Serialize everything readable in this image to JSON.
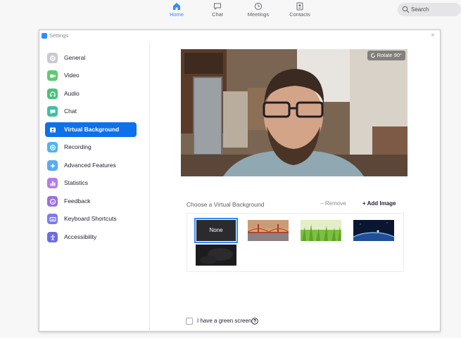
{
  "nav": {
    "home": "Home",
    "chat": "Chat",
    "meetings": "Meetings",
    "contacts": "Contacts",
    "search_placeholder": "Search"
  },
  "window": {
    "title": "Settings",
    "close_glyph": "×"
  },
  "sidebar": {
    "items": [
      {
        "label": "General",
        "icon": "gear-icon",
        "color": "#c9c9d0"
      },
      {
        "label": "Video",
        "icon": "video-camera-icon",
        "color": "#5ecb72"
      },
      {
        "label": "Audio",
        "icon": "headphones-icon",
        "color": "#4cc07d"
      },
      {
        "label": "Chat",
        "icon": "chat-bubble-icon",
        "color": "#3fbfa6"
      },
      {
        "label": "Virtual Background",
        "icon": "person-frame-icon",
        "color": "#ffffff",
        "active": true
      },
      {
        "label": "Recording",
        "icon": "record-icon",
        "color": "#4fb4f5"
      },
      {
        "label": "Advanced Features",
        "icon": "sparkle-icon",
        "color": "#5aaaf5"
      },
      {
        "label": "Statistics",
        "icon": "bar-chart-icon",
        "color": "#b57de6"
      },
      {
        "label": "Feedback",
        "icon": "smiley-icon",
        "color": "#9b6fe0"
      },
      {
        "label": "Keyboard Shortcuts",
        "icon": "keyboard-icon",
        "color": "#7f7ce8"
      },
      {
        "label": "Accessibility",
        "icon": "accessibility-icon",
        "color": "#6d6ddf"
      }
    ]
  },
  "main": {
    "rotate_label": "Rotate 90°",
    "choose_label": "Choose a Virtual Background",
    "remove_label": "Remove",
    "add_image_label": "Add Image",
    "thumbnails": {
      "none_label": "None",
      "images": [
        "golden-gate-bridge-thumbnail",
        "grass-thumbnail",
        "earth-from-space-thumbnail",
        "dark-custom-thumbnail"
      ]
    },
    "green_screen_label": "I have a green screen"
  },
  "colors": {
    "accent": "#2d8cff",
    "active_item": "#0e71eb"
  }
}
